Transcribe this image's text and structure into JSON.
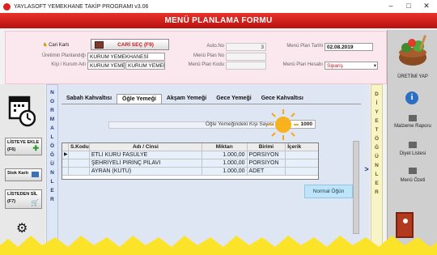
{
  "window": {
    "title": "YAYLASOFT YEMEKHANE TAKİP PROGRAMI v3.06",
    "minimize": "–",
    "maximize": "□",
    "close": "✕"
  },
  "header": {
    "title": "MENÜ PLANLAMA FORMU"
  },
  "form": {
    "cari_karti_label": "Cari Kartı",
    "cari_sec_label": "CARİ SEÇ (F9)",
    "uretim_planlandigi_label": "Üretimin Planlandığı",
    "uretim_planlandigi_value": "KURUM YEMEKHANESİ",
    "kisi_kurum_label": "Kişi / Kurum Adı",
    "kisi_kurum_value1": "KURUM YEMEKI",
    "kisi_kurum_value2": "KURUM YEMEKI",
    "auto_no_label": "Auto.No",
    "auto_no_value": "3",
    "menu_plan_no_label": "Menü Plan No",
    "menu_plan_no_value": "",
    "menu_plan_kodu_label": "Menü Plan Kodu",
    "menu_plan_kodu_value": "",
    "menu_plan_tarihi_label": "Menü Plan Tarihi",
    "menu_plan_tarihi_value": "02.08.2019",
    "menu_plan_hesabi_label": "Menü Plan Hesabı",
    "menu_plan_hesabi_value": "Sipariş"
  },
  "right_panel": {
    "uretimi_yap": "ÜRETİMİ YAP",
    "malzeme_raporu": "Malzeme Raporu",
    "diyet_listesi": "Diyet Listesi",
    "menu_ozeti": "Menü Özeti"
  },
  "left_panel": {
    "listeye_ekle": "LİSTEYE EKLE",
    "listeye_ekle_key": "(F6)",
    "stok_karti": "Stok Kartı",
    "listeden_sil": "LİSTEDEN SİL",
    "listeden_sil_key": "(F7)"
  },
  "normal_strip": [
    "N",
    "O",
    "R",
    "M",
    "A",
    "L",
    "",
    "Ö",
    "Ğ",
    "Ü",
    "N",
    "L",
    "E",
    "R"
  ],
  "diyet_strip": [
    "D",
    "İ",
    "Y",
    "E",
    "T",
    "",
    "Ö",
    "Ğ",
    "Ü",
    "N",
    "L",
    "E",
    "R"
  ],
  "tabs": [
    "Sabah Kahvaltısı",
    "Öğle Yemeği",
    "Akşam Yemeği",
    "Gece Yemeği",
    "Gece Kahvaltısı"
  ],
  "active_tab": "Öğle Yemeği",
  "kisi_sayisi_label": "Öğle Yemeğindeki Kişi Sayısı :",
  "kisi_sayisi_value": "1000",
  "grid": {
    "headers": [
      "S.Kodu",
      "Adı / Cinsi",
      "Miktarı",
      "Birimi",
      "İçerik"
    ],
    "rows": [
      {
        "kod": "",
        "ad": "ETLİ KURU FASÜLYE",
        "miktar": "1.000,00",
        "birim": "PORSİYON",
        "icerik": ""
      },
      {
        "kod": "",
        "ad": "ŞEHRİYELİ PİRİNÇ PİLAVI",
        "miktar": "1.000,00",
        "birim": "PORSİYON",
        "icerik": ""
      },
      {
        "kod": "",
        "ad": "AYRAN (KUTU)",
        "miktar": "1.000,00",
        "birim": "ADET",
        "icerik": ""
      }
    ]
  },
  "normal_ogun_button": "Normal Öğün",
  "arrow_label": ">",
  "colors": {
    "header_red": "#d8231f",
    "form_bg": "#fbe7ee",
    "grid_selected": "#e6f0fb",
    "strip_blue": "#1d3c7a"
  }
}
